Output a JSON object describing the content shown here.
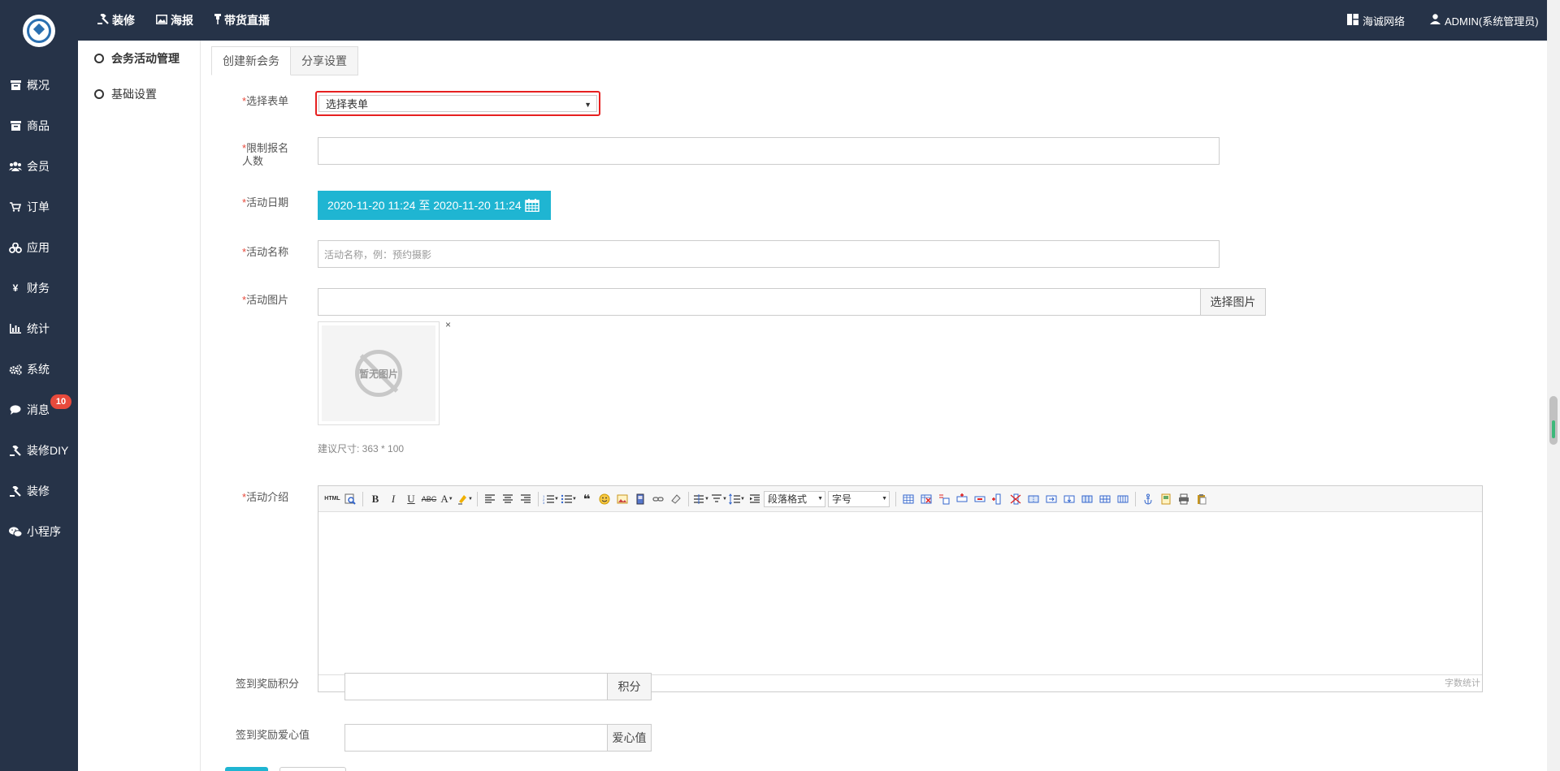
{
  "sidebar": {
    "items": [
      {
        "label": "概况",
        "icon": "dashboard-icon"
      },
      {
        "label": "商品",
        "icon": "box-icon"
      },
      {
        "label": "会员",
        "icon": "users-icon"
      },
      {
        "label": "订单",
        "icon": "cart-icon"
      },
      {
        "label": "应用",
        "icon": "cubes-icon"
      },
      {
        "label": "财务",
        "icon": "yen-icon"
      },
      {
        "label": "统计",
        "icon": "bar-chart-icon"
      },
      {
        "label": "系统",
        "icon": "gears-icon"
      },
      {
        "label": "消息",
        "icon": "comment-icon",
        "badge": "10"
      },
      {
        "label": "装修DIY",
        "icon": "gavel-icon"
      },
      {
        "label": "装修",
        "icon": "gavel-icon"
      },
      {
        "label": "小程序",
        "icon": "wechat-icon"
      }
    ]
  },
  "topbar": {
    "links": [
      "装修",
      "海报",
      "带货直播"
    ],
    "org": "海诚网络",
    "user": "ADMIN(系统管理员)"
  },
  "subnav": {
    "items": [
      "会务活动管理",
      "基础设置"
    ]
  },
  "tabs": [
    "创建新会务",
    "分享设置"
  ],
  "form": {
    "select_form_label": "选择表单",
    "select_form_value": "选择表单",
    "limit_label": "限制报名人数",
    "limit_value": "",
    "date_label": "活动日期",
    "date_value": "2020-11-20 11:24 至 2020-11-20 11:24",
    "name_label": "活动名称",
    "name_placeholder": "活动名称，例：预约摄影",
    "image_label": "活动图片",
    "image_button": "选择图片",
    "no_image_text": "暂无图片",
    "size_hint": "建议尺寸: 363 * 100",
    "intro_label": "活动介绍",
    "paragraph_format": "段落格式",
    "font_size": "字号",
    "word_count": "字数统计",
    "signin_points_label": "签到奖励积分",
    "signin_points_unit": "积分",
    "signin_love_label": "签到奖励爱心值",
    "signin_love_unit": "爱心值",
    "close_mark": "×",
    "html_button": "HTML"
  },
  "colors": {
    "sidebar_bg": "#263348",
    "accent": "#1fb5d2",
    "highlight_border": "#e62020",
    "badge": "#e84a3c"
  }
}
